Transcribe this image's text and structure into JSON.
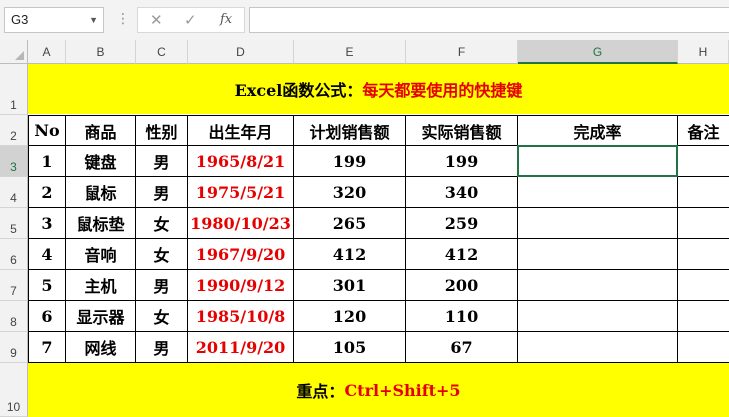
{
  "formula_bar": {
    "name_box": "G3",
    "formula": ""
  },
  "columns": [
    "A",
    "B",
    "C",
    "D",
    "E",
    "F",
    "G",
    "H"
  ],
  "row_numbers": [
    "1",
    "2",
    "3",
    "4",
    "5",
    "6",
    "7",
    "8",
    "9",
    "10"
  ],
  "title_banner": {
    "black": "Excel函数公式：",
    "red": "每天都要使用的快捷键"
  },
  "header": [
    "No",
    "商品",
    "性别",
    "出生年月",
    "计划销售额",
    "实际销售额",
    "完成率",
    "备注"
  ],
  "rows": [
    [
      "1",
      "键盘",
      "男",
      "1965/8/21",
      "199",
      "199",
      "",
      ""
    ],
    [
      "2",
      "鼠标",
      "男",
      "1975/5/21",
      "320",
      "340",
      "",
      ""
    ],
    [
      "3",
      "鼠标垫",
      "女",
      "1980/10/23",
      "265",
      "259",
      "",
      ""
    ],
    [
      "4",
      "音响",
      "女",
      "1967/9/20",
      "412",
      "412",
      "",
      ""
    ],
    [
      "5",
      "主机",
      "男",
      "1990/9/12",
      "301",
      "200",
      "",
      ""
    ],
    [
      "6",
      "显示器",
      "女",
      "1985/10/8",
      "120",
      "110",
      "",
      ""
    ],
    [
      "7",
      "网线",
      "男",
      "2011/9/20",
      "105",
      "67",
      "",
      ""
    ]
  ],
  "footer_banner": {
    "black": "重点：",
    "red": "Ctrl+Shift+5"
  },
  "selected_cell": "G3",
  "colors": {
    "highlight": "#ffff00",
    "red_text": "#e60000",
    "selection": "#217346"
  }
}
